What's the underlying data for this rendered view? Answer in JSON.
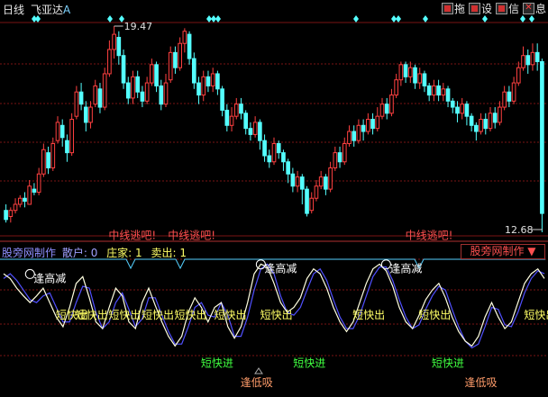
{
  "header": {
    "period": "日线",
    "stock_name": "飞亚达",
    "stock_mark": "A",
    "toolbar": [
      {
        "icon": "drag-icon",
        "label": "拖"
      },
      {
        "icon": "settings-icon",
        "label": "设"
      },
      {
        "icon": "info-icon",
        "label": "信"
      },
      {
        "icon": "close-icon",
        "label": "息"
      }
    ]
  },
  "price_panel": {
    "high_label": "19.47",
    "low_label": "12.68",
    "colors": {
      "up": "#ff4040",
      "down": "#54ffff",
      "grid": "#7a1515",
      "diamond": "#54ffff"
    }
  },
  "indicator_panel": {
    "title": "股旁网制作",
    "field_a": "散户: 0",
    "field_b": "庄家: 1",
    "field_c": "卖出: 1",
    "badge": "股旁网制作 ▼"
  },
  "chart_data": {
    "type": "candlestick",
    "high": 19.47,
    "low": 12.68,
    "candles": [
      [
        13.4,
        13.1,
        13.6,
        13.0
      ],
      [
        13.2,
        13.4,
        13.5,
        13.0
      ],
      [
        13.4,
        13.6,
        13.8,
        13.3
      ],
      [
        13.6,
        13.8,
        13.9,
        13.5
      ],
      [
        13.8,
        13.7,
        14.0,
        13.5
      ],
      [
        13.6,
        14.2,
        14.4,
        13.6
      ],
      [
        14.1,
        14.0,
        14.3,
        13.9
      ],
      [
        14.0,
        14.6,
        14.8,
        13.9
      ],
      [
        14.6,
        15.4,
        15.6,
        14.5
      ],
      [
        15.3,
        14.8,
        15.5,
        14.6
      ],
      [
        14.8,
        15.6,
        15.8,
        14.7
      ],
      [
        15.7,
        16.3,
        16.5,
        15.6
      ],
      [
        16.2,
        15.8,
        16.4,
        15.5
      ],
      [
        15.7,
        15.3,
        15.9,
        15.0
      ],
      [
        15.3,
        16.4,
        16.6,
        15.2
      ],
      [
        16.5,
        17.3,
        17.5,
        16.4
      ],
      [
        17.3,
        16.9,
        17.6,
        16.7
      ],
      [
        16.8,
        16.3,
        17.0,
        16.0
      ],
      [
        16.3,
        16.8,
        17.0,
        16.1
      ],
      [
        16.9,
        17.5,
        17.7,
        16.8
      ],
      [
        17.4,
        16.8,
        17.6,
        16.6
      ],
      [
        16.8,
        17.9,
        18.1,
        16.7
      ],
      [
        17.9,
        18.7,
        19.0,
        17.8
      ],
      [
        18.7,
        19.2,
        19.47,
        18.4
      ],
      [
        19.1,
        18.5,
        19.3,
        18.2
      ],
      [
        18.5,
        17.6,
        18.7,
        17.4
      ],
      [
        17.6,
        17.1,
        17.8,
        16.9
      ],
      [
        17.1,
        17.8,
        18.0,
        16.9
      ],
      [
        17.8,
        17.3,
        18.0,
        17.1
      ],
      [
        17.3,
        17.0,
        17.5,
        16.8
      ],
      [
        17.0,
        17.6,
        17.8,
        16.9
      ],
      [
        17.6,
        18.2,
        18.4,
        17.5
      ],
      [
        18.2,
        17.5,
        18.3,
        17.3
      ],
      [
        17.5,
        16.9,
        17.7,
        16.7
      ],
      [
        16.9,
        17.6,
        17.9,
        16.8
      ],
      [
        17.7,
        18.6,
        18.8,
        17.6
      ],
      [
        18.6,
        18.1,
        18.8,
        17.9
      ],
      [
        18.1,
        18.9,
        19.1,
        18.0
      ],
      [
        18.9,
        19.3,
        19.4,
        18.6
      ],
      [
        19.2,
        18.4,
        19.3,
        18.2
      ],
      [
        18.4,
        17.6,
        18.6,
        17.4
      ],
      [
        17.6,
        17.2,
        17.8,
        16.9
      ],
      [
        17.2,
        17.8,
        18.0,
        17.0
      ],
      [
        17.8,
        17.5,
        18.0,
        17.3
      ],
      [
        17.5,
        17.9,
        18.1,
        17.3
      ],
      [
        17.9,
        17.4,
        18.0,
        17.2
      ],
      [
        17.4,
        16.7,
        17.5,
        16.5
      ],
      [
        16.7,
        16.2,
        16.9,
        16.0
      ],
      [
        16.2,
        16.5,
        16.8,
        16.0
      ],
      [
        16.5,
        16.9,
        17.1,
        16.4
      ],
      [
        16.9,
        16.6,
        17.1,
        16.4
      ],
      [
        16.6,
        16.1,
        16.7,
        15.9
      ],
      [
        16.1,
        15.9,
        16.3,
        15.7
      ],
      [
        15.9,
        16.3,
        16.5,
        15.8
      ],
      [
        16.3,
        15.7,
        16.4,
        15.4
      ],
      [
        15.7,
        15.2,
        15.9,
        15.0
      ],
      [
        15.2,
        15.0,
        15.4,
        14.8
      ],
      [
        15.0,
        15.6,
        15.8,
        14.9
      ],
      [
        15.6,
        15.3,
        15.7,
        15.1
      ],
      [
        15.3,
        15.0,
        15.4,
        14.7
      ],
      [
        15.0,
        14.6,
        15.1,
        14.3
      ],
      [
        14.6,
        14.2,
        14.8,
        14.0
      ],
      [
        14.2,
        14.5,
        14.7,
        14.0
      ],
      [
        14.5,
        14.1,
        14.6,
        13.6
      ],
      [
        14.1,
        13.3,
        14.2,
        13.2
      ],
      [
        13.4,
        13.8,
        14.0,
        13.3
      ],
      [
        13.8,
        14.2,
        14.4,
        13.7
      ],
      [
        14.2,
        14.5,
        14.7,
        14.1
      ],
      [
        14.5,
        14.1,
        14.6,
        13.9
      ],
      [
        14.1,
        14.8,
        15.0,
        14.0
      ],
      [
        14.8,
        15.3,
        15.5,
        14.7
      ],
      [
        15.3,
        15.0,
        15.5,
        14.8
      ],
      [
        15.0,
        15.6,
        15.8,
        14.9
      ],
      [
        15.6,
        16.0,
        16.2,
        15.5
      ],
      [
        16.0,
        15.7,
        16.2,
        15.5
      ],
      [
        15.7,
        16.2,
        16.4,
        15.6
      ],
      [
        16.2,
        16.0,
        16.4,
        15.7
      ],
      [
        16.0,
        16.4,
        16.6,
        15.9
      ],
      [
        16.4,
        16.1,
        16.6,
        15.9
      ],
      [
        16.1,
        16.5,
        16.8,
        16.0
      ],
      [
        16.5,
        16.9,
        17.1,
        16.4
      ],
      [
        16.9,
        16.6,
        17.1,
        16.4
      ],
      [
        16.6,
        17.2,
        17.4,
        16.5
      ],
      [
        17.2,
        17.7,
        17.9,
        17.1
      ],
      [
        17.7,
        18.2,
        18.3,
        17.5
      ],
      [
        18.2,
        17.8,
        18.3,
        17.6
      ],
      [
        17.8,
        18.1,
        18.3,
        17.6
      ],
      [
        18.1,
        17.6,
        18.2,
        17.4
      ],
      [
        17.6,
        17.9,
        18.1,
        17.4
      ],
      [
        17.9,
        17.5,
        18.0,
        17.3
      ],
      [
        17.5,
        17.2,
        17.6,
        17.0
      ],
      [
        17.2,
        17.5,
        17.7,
        17.0
      ],
      [
        17.5,
        17.2,
        17.7,
        17.0
      ],
      [
        17.2,
        17.4,
        17.6,
        17.0
      ],
      [
        17.4,
        17.0,
        17.5,
        16.8
      ],
      [
        17.0,
        16.8,
        17.1,
        16.6
      ],
      [
        16.8,
        16.6,
        17.0,
        16.3
      ],
      [
        16.6,
        16.9,
        17.1,
        16.4
      ],
      [
        16.9,
        16.5,
        17.0,
        16.2
      ],
      [
        16.5,
        16.2,
        16.6,
        16.0
      ],
      [
        16.2,
        16.0,
        16.3,
        15.7
      ],
      [
        16.0,
        16.4,
        16.6,
        15.9
      ],
      [
        16.4,
        16.1,
        16.6,
        15.9
      ],
      [
        16.1,
        16.6,
        16.8,
        16.0
      ],
      [
        16.6,
        16.3,
        16.8,
        16.1
      ],
      [
        16.3,
        16.8,
        17.0,
        16.2
      ],
      [
        16.8,
        17.3,
        17.5,
        16.7
      ],
      [
        17.3,
        17.0,
        17.5,
        16.8
      ],
      [
        17.0,
        17.6,
        17.8,
        16.9
      ],
      [
        17.6,
        18.1,
        18.3,
        17.5
      ],
      [
        18.1,
        18.5,
        18.8,
        18.0
      ],
      [
        18.5,
        18.2,
        18.7,
        17.9
      ],
      [
        18.2,
        18.6,
        18.9,
        18.0
      ],
      [
        18.6,
        18.3,
        18.9,
        18.0
      ],
      [
        18.3,
        13.3,
        18.4,
        12.68
      ]
    ],
    "diamonds_x": [
      38,
      42,
      122,
      135,
      232,
      237,
      242,
      395,
      437,
      442,
      472,
      538,
      580,
      590
    ],
    "indicator": {
      "white": [
        0.85,
        0.8,
        0.7,
        0.62,
        0.55,
        0.62,
        0.7,
        0.55,
        0.4,
        0.3,
        0.5,
        0.75,
        0.82,
        0.6,
        0.35,
        0.28,
        0.5,
        0.7,
        0.62,
        0.35,
        0.28,
        0.55,
        0.7,
        0.52,
        0.35,
        0.2,
        0.1,
        0.2,
        0.45,
        0.6,
        0.5,
        0.35,
        0.5,
        0.55,
        0.3,
        0.18,
        0.3,
        0.55,
        0.85,
        0.95,
        0.92,
        0.75,
        0.55,
        0.45,
        0.5,
        0.6,
        0.8,
        0.9,
        0.85,
        0.7,
        0.5,
        0.35,
        0.25,
        0.35,
        0.55,
        0.75,
        0.9,
        0.95,
        0.88,
        0.72,
        0.5,
        0.35,
        0.28,
        0.42,
        0.58,
        0.68,
        0.75,
        0.6,
        0.4,
        0.25,
        0.15,
        0.1,
        0.2,
        0.4,
        0.55,
        0.4,
        0.28,
        0.35,
        0.55,
        0.75,
        0.85,
        0.9,
        0.8
      ],
      "blue": [
        0.8,
        0.85,
        0.78,
        0.68,
        0.58,
        0.55,
        0.62,
        0.65,
        0.5,
        0.35,
        0.35,
        0.55,
        0.72,
        0.7,
        0.45,
        0.28,
        0.35,
        0.55,
        0.65,
        0.48,
        0.3,
        0.38,
        0.6,
        0.6,
        0.42,
        0.25,
        0.12,
        0.12,
        0.3,
        0.5,
        0.55,
        0.42,
        0.4,
        0.55,
        0.42,
        0.2,
        0.2,
        0.4,
        0.68,
        0.9,
        0.95,
        0.85,
        0.62,
        0.45,
        0.42,
        0.5,
        0.68,
        0.85,
        0.9,
        0.78,
        0.58,
        0.4,
        0.28,
        0.28,
        0.42,
        0.62,
        0.82,
        0.92,
        0.92,
        0.78,
        0.58,
        0.4,
        0.28,
        0.32,
        0.48,
        0.62,
        0.72,
        0.68,
        0.48,
        0.3,
        0.15,
        0.08,
        0.12,
        0.3,
        0.5,
        0.48,
        0.32,
        0.3,
        0.45,
        0.65,
        0.8,
        0.88,
        0.85
      ]
    },
    "labels": [
      {
        "text": "逢高减",
        "kind": "sell_high",
        "idx": 4,
        "yl": 0.8
      },
      {
        "text": "逢高减",
        "kind": "sell_high",
        "idx": 39,
        "yl": 0.9
      },
      {
        "text": "逢高减",
        "kind": "sell_high",
        "idx": 58,
        "yl": 0.9
      },
      {
        "text": "中线逃吧!",
        "kind": "mid_exit",
        "idx": 17,
        "yl": 1.25
      },
      {
        "text": "中线逃吧!",
        "kind": "mid_exit",
        "idx": 26,
        "yl": 1.25
      },
      {
        "text": "中线逃吧!",
        "kind": "mid_exit",
        "idx": 62,
        "yl": 1.25
      },
      {
        "text": "短快出",
        "kind": "short_exit",
        "idx": 9,
        "yl": 0.42
      },
      {
        "text": "短快出",
        "kind": "short_exit",
        "idx": 12,
        "yl": 0.42
      },
      {
        "text": "短快出",
        "kind": "short_exit",
        "idx": 17,
        "yl": 0.42
      },
      {
        "text": "短快出",
        "kind": "short_exit",
        "idx": 22,
        "yl": 0.42
      },
      {
        "text": "短快出",
        "kind": "short_exit",
        "idx": 27,
        "yl": 0.42
      },
      {
        "text": "短快出",
        "kind": "short_exit",
        "idx": 33,
        "yl": 0.42
      },
      {
        "text": "短快出",
        "kind": "short_exit",
        "idx": 40,
        "yl": 0.42
      },
      {
        "text": "短快出",
        "kind": "short_exit",
        "idx": 54,
        "yl": 0.42
      },
      {
        "text": "短快出",
        "kind": "short_exit",
        "idx": 64,
        "yl": 0.42
      },
      {
        "text": "短快出",
        "kind": "short_exit",
        "idx": 80,
        "yl": 0.42
      },
      {
        "text": "短快进",
        "kind": "short_buy",
        "idx": 31,
        "yl": -0.08
      },
      {
        "text": "短快进",
        "kind": "short_buy",
        "idx": 45,
        "yl": -0.08
      },
      {
        "text": "短快进",
        "kind": "short_buy",
        "idx": 66,
        "yl": -0.08
      },
      {
        "text": "逢低吸",
        "kind": "buy_low",
        "idx": 37,
        "yl": -0.28
      },
      {
        "text": "逢低吸",
        "kind": "buy_low",
        "idx": 71,
        "yl": -0.28
      }
    ]
  }
}
